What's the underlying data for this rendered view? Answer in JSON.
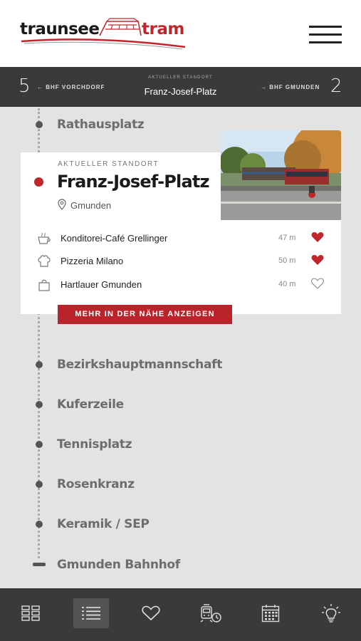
{
  "header": {
    "logo_word1": "traunsee",
    "logo_word2": "tram"
  },
  "location_bar": {
    "left_count": "5",
    "left_direction": "← BHF VORCHDORF",
    "current_label": "AKTUELLER STANDORT",
    "current_name": "Franz-Josef-Platz",
    "right_direction": "→ BHF GMUNDEN",
    "right_count": "2"
  },
  "stops_before": [
    {
      "name": "Rathausplatz"
    }
  ],
  "current_stop": {
    "label": "AKTUELLER STANDORT",
    "name": "Franz-Josef-Platz",
    "city": "Gmunden",
    "pois": [
      {
        "icon": "coffee-cup-icon",
        "name": "Konditorei-Café Grellinger",
        "distance": "47 m",
        "favorite": true
      },
      {
        "icon": "chef-hat-icon",
        "name": "Pizzeria Milano",
        "distance": "50 m",
        "favorite": true
      },
      {
        "icon": "shopping-bag-icon",
        "name": "Hartlauer Gmunden",
        "distance": "40 m",
        "favorite": false
      }
    ],
    "more_button": "MEHR IN DER NÄHE ANZEIGEN"
  },
  "stops_after": [
    {
      "name": "Bezirkshauptmannschaft"
    },
    {
      "name": "Kuferzeile"
    },
    {
      "name": "Tennisplatz"
    },
    {
      "name": "Rosenkranz"
    },
    {
      "name": "Keramik / SEP"
    },
    {
      "name": "Gmunden Bahnhof"
    }
  ],
  "bottom_nav": [
    {
      "icon": "grid-icon",
      "active": false
    },
    {
      "icon": "list-icon",
      "active": true
    },
    {
      "icon": "heart-icon",
      "active": false
    },
    {
      "icon": "tram-clock-icon",
      "active": false
    },
    {
      "icon": "calendar-icon",
      "active": false
    },
    {
      "icon": "lightbulb-icon",
      "active": false
    }
  ],
  "colors": {
    "accent": "#c0272d",
    "bar": "#3a3a3a",
    "background": "#e3e3e3"
  }
}
